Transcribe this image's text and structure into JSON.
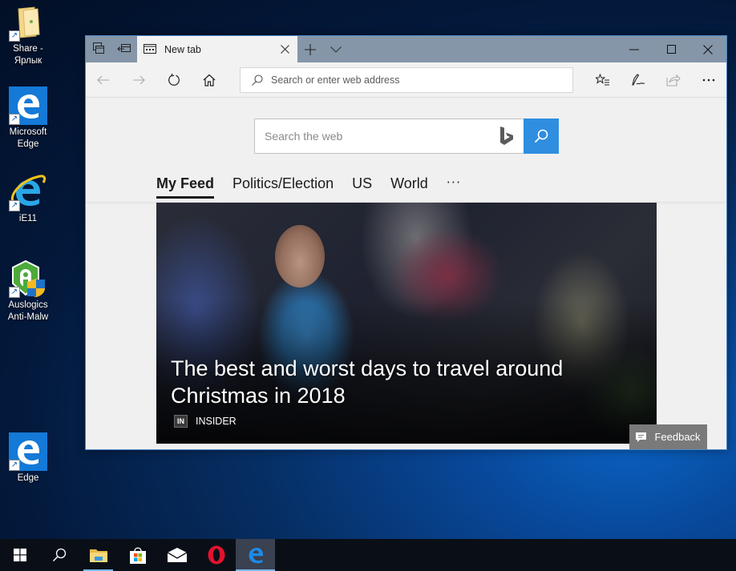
{
  "desktop": {
    "icons": [
      {
        "label_line1": "Share -",
        "label_line2": "Ярлык",
        "icon": "folder-icon"
      },
      {
        "label_line1": "Microsoft",
        "label_line2": "Edge",
        "icon": "edge-icon"
      },
      {
        "label_line1": "iE11",
        "label_line2": "",
        "icon": "internet-explorer-icon"
      },
      {
        "label_line1": "Auslogics",
        "label_line2": "Anti-Malw",
        "icon": "auslogics-icon"
      },
      {
        "label_line1": "Edge",
        "label_line2": "",
        "icon": "edge-icon"
      }
    ]
  },
  "browser": {
    "tab": {
      "title": "New tab"
    },
    "address_bar": {
      "placeholder": "Search or enter web address",
      "value": ""
    },
    "new_tab_page": {
      "search": {
        "placeholder": "Search the web",
        "value": ""
      },
      "feed_tabs": [
        {
          "label": "My Feed",
          "active": true
        },
        {
          "label": "Politics/Election",
          "active": false
        },
        {
          "label": "US",
          "active": false
        },
        {
          "label": "World",
          "active": false
        }
      ],
      "more_label": "···",
      "hero": {
        "title": "The best and worst days to travel around Christmas in 2018",
        "source_logo": "IN",
        "source_name": "INSIDER"
      }
    }
  },
  "feedback": {
    "label": "Feedback"
  },
  "taskbar": {
    "items": [
      {
        "name": "start-button",
        "icon": "windows-logo-icon"
      },
      {
        "name": "search-button",
        "icon": "search-icon"
      },
      {
        "name": "file-explorer",
        "icon": "folder-icon"
      },
      {
        "name": "microsoft-store",
        "icon": "store-icon"
      },
      {
        "name": "mail",
        "icon": "mail-icon"
      },
      {
        "name": "opera",
        "icon": "opera-icon"
      },
      {
        "name": "edge",
        "icon": "edge-icon"
      }
    ]
  },
  "colors": {
    "accent": "#2f8ee0",
    "titlebar": "#8596a8",
    "taskbar_indicator": "#76b9ed"
  }
}
